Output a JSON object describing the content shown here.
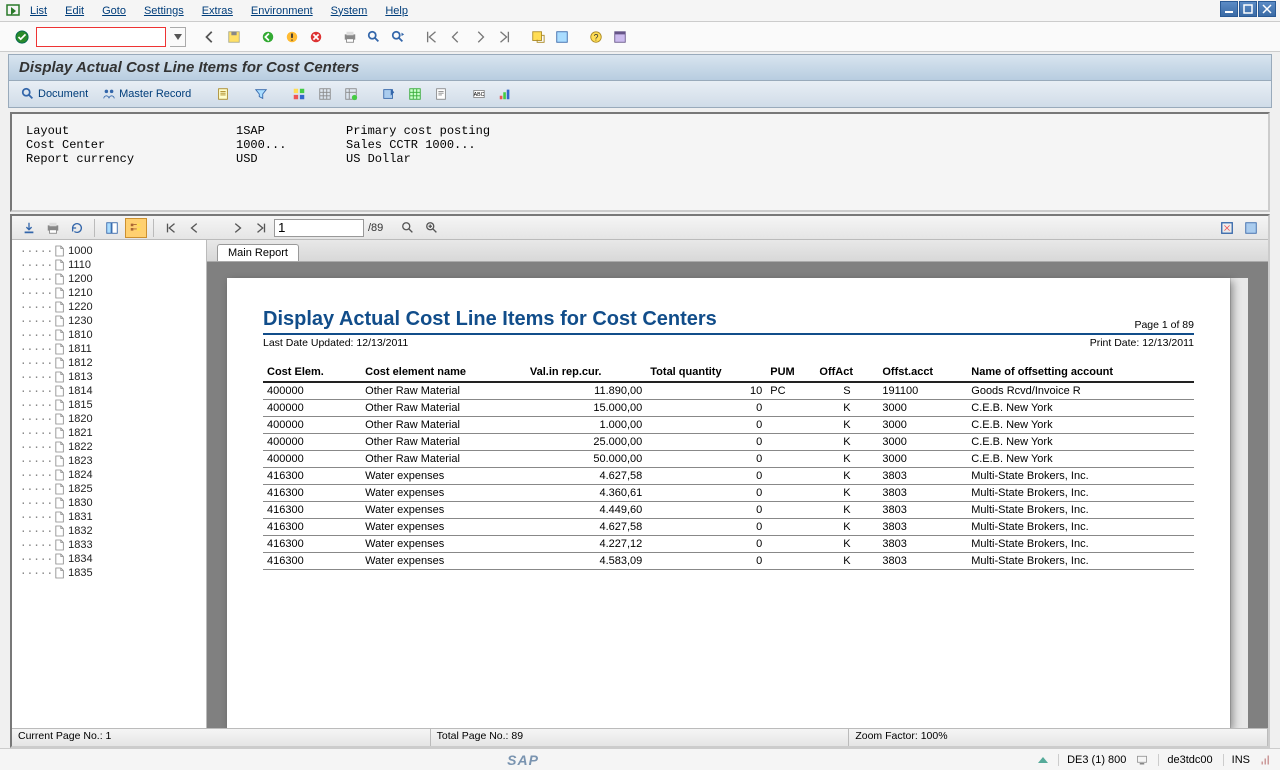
{
  "menu": {
    "items": [
      "List",
      "Edit",
      "Goto",
      "Settings",
      "Extras",
      "Environment",
      "System",
      "Help"
    ]
  },
  "title": "Display Actual Cost Line Items for Cost Centers",
  "app_toolbar": {
    "document": "Document",
    "master_record": "Master Record"
  },
  "info": {
    "rows": [
      {
        "label": "Layout",
        "val1": "1SAP",
        "val2": "Primary cost posting"
      },
      {
        "label": "Cost Center",
        "val1": "1000...",
        "val2": "Sales CCTR 1000..."
      },
      {
        "label": "Report currency",
        "val1": "USD",
        "val2": "US Dollar"
      }
    ]
  },
  "report_nav": {
    "page_input": "1",
    "page_total": "/89"
  },
  "tree": {
    "items": [
      "1000",
      "1110",
      "1200",
      "1210",
      "1220",
      "1230",
      "1810",
      "1811",
      "1812",
      "1813",
      "1814",
      "1815",
      "1820",
      "1821",
      "1822",
      "1823",
      "1824",
      "1825",
      "1830",
      "1831",
      "1832",
      "1833",
      "1834",
      "1835"
    ]
  },
  "tab": "Main Report",
  "report": {
    "title": "Display Actual Cost Line Items for Cost Centers",
    "page_label": "Page 1 of 89",
    "last_updated_label": "Last Date Updated:",
    "last_updated": "12/13/2011",
    "print_date_label": "Print Date:",
    "print_date": "12/13/2011",
    "columns": [
      "Cost Elem.",
      "Cost element name",
      "Val.in rep.cur.",
      "Total quantity",
      "PUM",
      "OffAct",
      "Offst.acct",
      "Name of offsetting account"
    ],
    "rows": [
      [
        "400000",
        "Other Raw Material",
        "11.890,00",
        "10",
        "PC",
        "S",
        "191100",
        "Goods Rcvd/Invoice R"
      ],
      [
        "400000",
        "Other Raw Material",
        "15.000,00",
        "0",
        "",
        "K",
        "3000",
        "C.E.B. New York"
      ],
      [
        "400000",
        "Other Raw Material",
        "1.000,00",
        "0",
        "",
        "K",
        "3000",
        "C.E.B. New York"
      ],
      [
        "400000",
        "Other Raw Material",
        "25.000,00",
        "0",
        "",
        "K",
        "3000",
        "C.E.B. New York"
      ],
      [
        "400000",
        "Other Raw Material",
        "50.000,00",
        "0",
        "",
        "K",
        "3000",
        "C.E.B. New York"
      ],
      [
        "416300",
        "Water expenses",
        "4.627,58",
        "0",
        "",
        "K",
        "3803",
        "Multi-State Brokers, Inc."
      ],
      [
        "416300",
        "Water expenses",
        "4.360,61",
        "0",
        "",
        "K",
        "3803",
        "Multi-State Brokers, Inc."
      ],
      [
        "416300",
        "Water expenses",
        "4.449,60",
        "0",
        "",
        "K",
        "3803",
        "Multi-State Brokers, Inc."
      ],
      [
        "416300",
        "Water expenses",
        "4.627,58",
        "0",
        "",
        "K",
        "3803",
        "Multi-State Brokers, Inc."
      ],
      [
        "416300",
        "Water expenses",
        "4.227,12",
        "0",
        "",
        "K",
        "3803",
        "Multi-State Brokers, Inc."
      ],
      [
        "416300",
        "Water expenses",
        "4.583,09",
        "0",
        "",
        "K",
        "3803",
        "Multi-State Brokers, Inc."
      ]
    ]
  },
  "rep_status": {
    "current": "Current Page No.: 1",
    "total": "Total Page No.: 89",
    "zoom": "Zoom Factor: 100%"
  },
  "sys_status": {
    "system": "DE3 (1) 800",
    "host": "de3tdc00",
    "mode": "INS"
  }
}
